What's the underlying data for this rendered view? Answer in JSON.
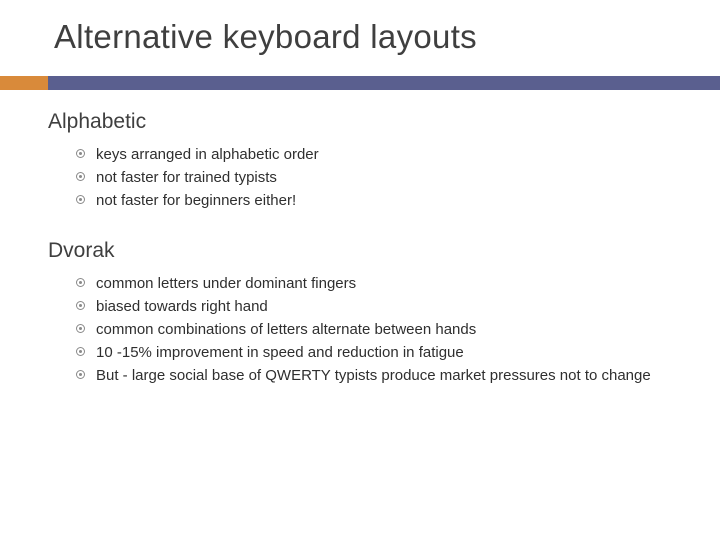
{
  "title": "Alternative keyboard layouts",
  "sections": [
    {
      "heading": "Alphabetic",
      "items": [
        "keys arranged in alphabetic order",
        "not faster for trained typists",
        "not faster for beginners either!"
      ]
    },
    {
      "heading": "Dvorak",
      "items": [
        "common letters under dominant fingers",
        "biased towards right hand",
        "common combinations of letters alternate between hands",
        "10 -15% improvement in speed and reduction in fatigue",
        "But - large social base of QWERTY typists produce market pressures not to change"
      ]
    }
  ]
}
